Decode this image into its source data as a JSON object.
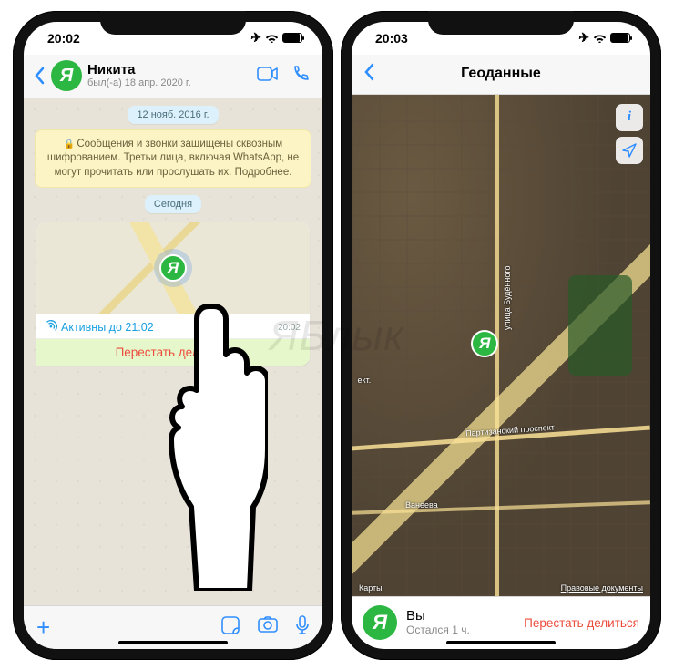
{
  "watermark": "ЯБлык",
  "phone1": {
    "time": "20:02",
    "chat": {
      "avatar_letter": "Я",
      "name": "Никита",
      "last_seen": "был(-а) 18 апр. 2020 г.",
      "date_pill": "12 нояб. 2016 г.",
      "encryption_notice": "Сообщения и звонки защищены сквозным шифрованием. Третьи лица, включая WhatsApp, не могут прочитать или прослушать их. Подробнее.",
      "today_pill": "Сегодня",
      "live_location": {
        "active_until": "Активны до 21:02",
        "timestamp": "20:02",
        "stop_label": "Перестать делиться"
      }
    }
  },
  "phone2": {
    "time": "20:03",
    "title": "Геоданные",
    "map": {
      "street_v": "улица Будённого",
      "street_h": "Партизанский проспект",
      "street_h2": "Ванеева",
      "street_l": "ект.",
      "provider": "Карты",
      "legal": "Правовые документы"
    },
    "footer": {
      "avatar_letter": "Я",
      "you_label": "Вы",
      "remaining": "Остался 1 ч.",
      "stop_label": "Перестать делиться"
    }
  }
}
